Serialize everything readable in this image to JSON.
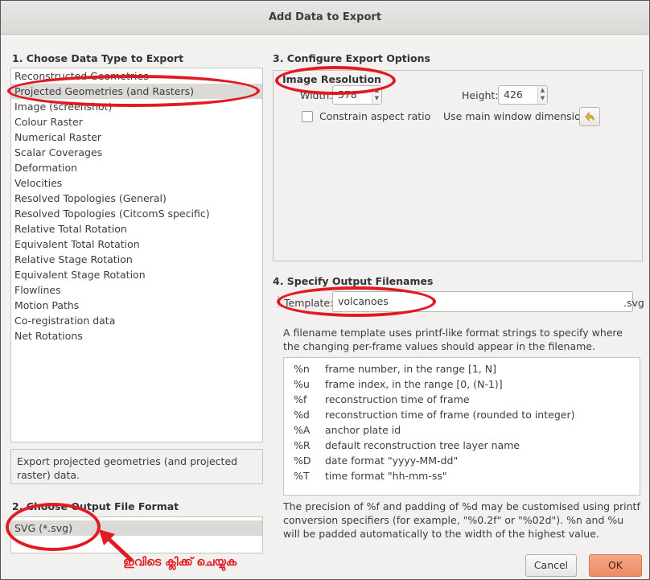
{
  "window": {
    "title": "Add Data to Export"
  },
  "section1": {
    "title": "1. Choose Data Type to Export",
    "items": [
      "Reconstructed Geometries",
      "Projected Geometries (and Rasters)",
      "Image (screenshot)",
      "Colour Raster",
      "Numerical Raster",
      "Scalar Coverages",
      "Deformation",
      "Velocities",
      "Resolved Topologies (General)",
      "Resolved Topologies (CitcomS specific)",
      "Relative Total Rotation",
      "Equivalent Total Rotation",
      "Relative Stage Rotation",
      "Equivalent Stage Rotation",
      "Flowlines",
      "Motion Paths",
      "Co-registration data",
      "Net Rotations"
    ],
    "selected_index": 1,
    "description": "Export projected geometries (and projected raster) data."
  },
  "section2": {
    "title": "2. Choose Output File Format",
    "formats": [
      "SVG (*.svg)"
    ]
  },
  "section3": {
    "title": "3. Configure Export Options",
    "group_title": "Image Resolution",
    "width_label": "Width:",
    "width_value": "578",
    "height_label": "Height:",
    "height_value": "426",
    "constrain_label": "Constrain aspect ratio",
    "constrain_checked": false,
    "main_window_label": "Use main window dimensions:"
  },
  "section4": {
    "title": "4. Specify Output Filenames",
    "template_label": "Template:",
    "template_value": "volcanoes",
    "extension": ".svg",
    "help_text": "A filename template uses printf-like format strings to specify where the changing per-frame values should appear in the filename.",
    "specifiers": [
      {
        "code": "%n",
        "desc": "frame number, in the range [1, N]"
      },
      {
        "code": "%u",
        "desc": "frame index, in the range [0, (N-1)]"
      },
      {
        "code": "%f",
        "desc": "reconstruction time of frame"
      },
      {
        "code": "%d",
        "desc": "reconstruction time of frame (rounded to integer)"
      },
      {
        "code": "%A",
        "desc": "anchor plate id"
      },
      {
        "code": "%R",
        "desc": "default reconstruction tree layer name"
      },
      {
        "code": "%D",
        "desc": "date format \"yyyy-MM-dd\""
      },
      {
        "code": "%T",
        "desc": "time format \"hh-mm-ss\""
      }
    ],
    "precision_note": "The precision of %f and padding of %d may be customised using printf conversion specifiers (for example, \"%0.2f\" or \"%02d\"). %n and %u will be padded automatically to the width of the highest value."
  },
  "buttons": {
    "cancel": "Cancel",
    "ok": "OK"
  },
  "annotation": {
    "text": "ഇവിടെ ക്ലിക്ക് ചെയ്യുക",
    "color": "#e21b23"
  },
  "colors": {
    "ok_button": "#ec8a63",
    "annotation_red": "#e21b23",
    "selection": "#dcdad6"
  }
}
